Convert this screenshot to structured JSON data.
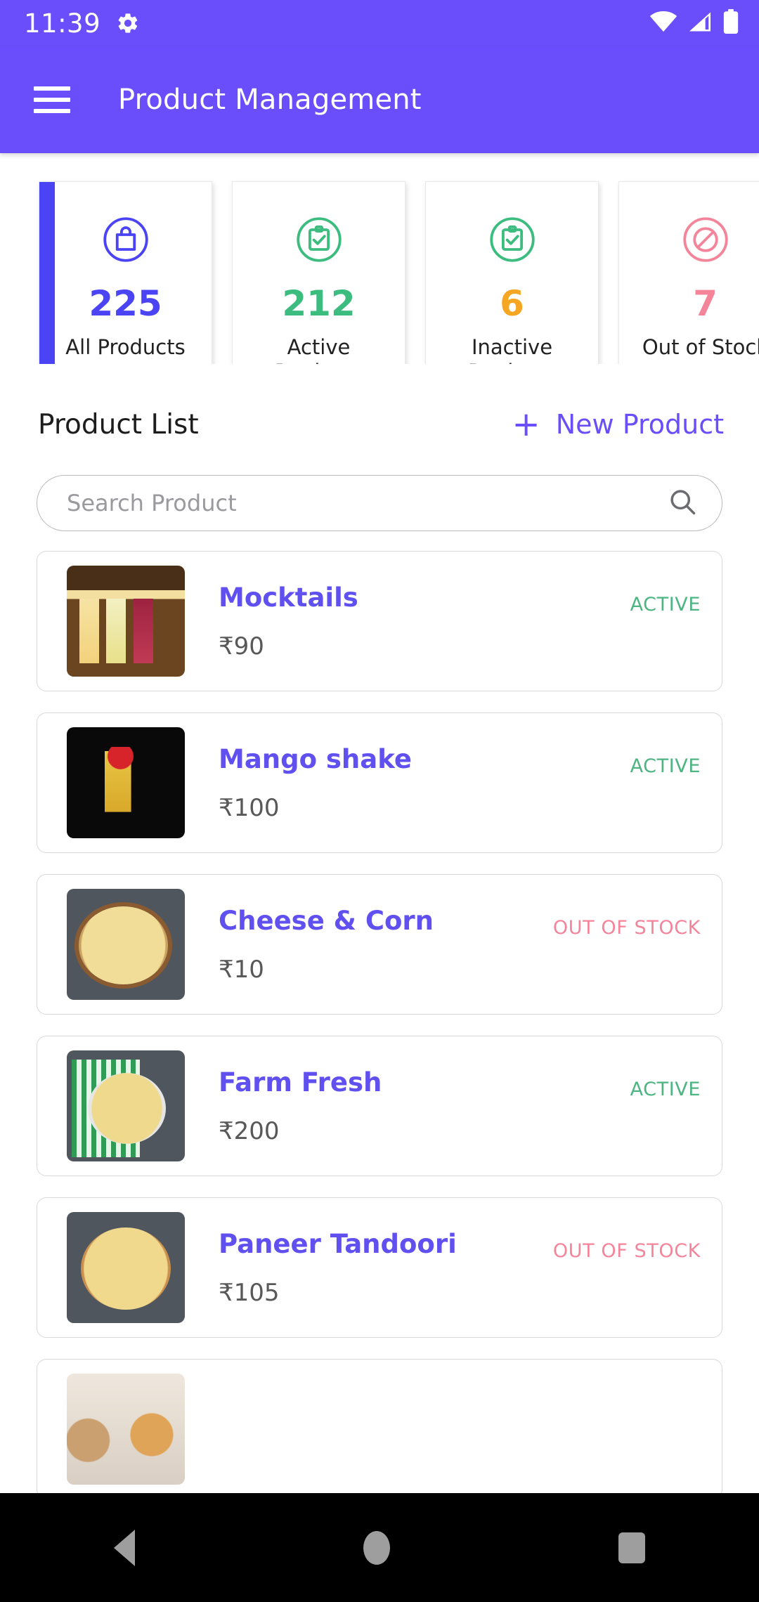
{
  "status_bar": {
    "time": "11:39",
    "icons": [
      "gear-icon",
      "wifi-icon",
      "cellular-signal-icon",
      "battery-icon"
    ]
  },
  "app_bar": {
    "menu_icon": "hamburger-menu-icon",
    "title": "Product Management",
    "background_color": "#6B4EFB"
  },
  "stats": [
    {
      "value": "225",
      "label": "All Products",
      "icon": "shopping-bag-icon",
      "color": "#4B44F5",
      "accent": true
    },
    {
      "value": "212",
      "label": "Active Products",
      "icon": "clipboard-check-icon",
      "color": "#3DBC7F",
      "accent": false
    },
    {
      "value": "6",
      "label": "Inactive Products",
      "icon": "clipboard-check-icon",
      "color": "#3DBC7F",
      "value_color": "#F5A623",
      "accent": false
    },
    {
      "value": "7",
      "label": "Out of Stock",
      "icon": "block-forbidden-icon",
      "color": "#F4849A",
      "accent": false
    }
  ],
  "list_header": {
    "title": "Product List",
    "new_product_label": "New Product",
    "plus": "+"
  },
  "search": {
    "placeholder": "Search Product",
    "value": "",
    "icon": "search-icon"
  },
  "products": [
    {
      "name": "Mocktails",
      "price": "₹90",
      "status": "ACTIVE",
      "status_type": "active",
      "image": "mocktails-thumbnail"
    },
    {
      "name": "Mango shake",
      "price": "₹100",
      "status": "ACTIVE",
      "status_type": "active",
      "image": "mango-shake-thumbnail"
    },
    {
      "name": "Cheese & Corn",
      "price": "₹10",
      "status": "OUT OF STOCK",
      "status_type": "out",
      "image": "cheese-corn-pizza-thumbnail"
    },
    {
      "name": "Farm Fresh",
      "price": "₹200",
      "status": "ACTIVE",
      "status_type": "active",
      "image": "farm-fresh-pizza-thumbnail"
    },
    {
      "name": "Paneer Tandoori",
      "price": "₹105",
      "status": "OUT OF STOCK",
      "status_type": "out",
      "image": "paneer-tandoori-pizza-thumbnail"
    }
  ],
  "nav_bar": {
    "back": "back-triangle-icon",
    "home": "home-circle-icon",
    "recents": "recents-square-icon"
  },
  "colors": {
    "brand_purple": "#6B4EFB",
    "accent_blue": "#4B44F5",
    "green": "#3DBC7F",
    "orange": "#F5A623",
    "pink": "#F4849A",
    "status_active": "#4CB581",
    "status_out": "#F4849A",
    "product_name": "#6150F0"
  }
}
